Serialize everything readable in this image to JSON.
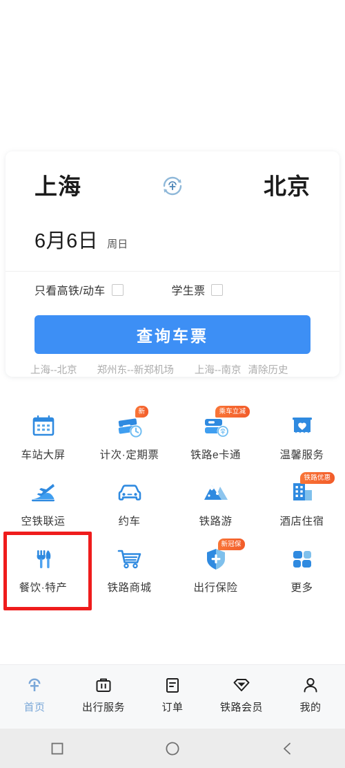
{
  "app": {
    "accent_blue": "#3d8ff5",
    "badge_orange": "#f4662e",
    "annotation_red": "#ef1c1c",
    "active_tab_color": "#7aa7d8"
  },
  "search_card": {
    "from_city": "上海",
    "to_city": "北京",
    "swap_icon": "swap-station-icon",
    "date": "6月6日",
    "weekday": "周日",
    "options": [
      {
        "label": "只看高铁/动车",
        "checked": false
      },
      {
        "label": "学生票",
        "checked": false
      }
    ],
    "query_button": "查询车票",
    "history": [
      "上海--北京",
      "郑州东--新郑机场",
      "上海--南京"
    ],
    "clear_history": "清除历史"
  },
  "services": [
    {
      "label": "车站大屏",
      "icon": "station-screen-icon",
      "badge": null
    },
    {
      "label": "计次·定期票",
      "icon": "multi-ride-ticket-icon",
      "badge": "新"
    },
    {
      "label": "铁路e卡通",
      "icon": "railway-ecard-icon",
      "badge": "乘车立减"
    },
    {
      "label": "温馨服务",
      "icon": "caring-service-icon",
      "badge": null
    },
    {
      "label": "空铁联运",
      "icon": "air-rail-transfer-icon",
      "badge": null
    },
    {
      "label": "约车",
      "icon": "hail-car-icon",
      "badge": null
    },
    {
      "label": "铁路游",
      "icon": "railway-tour-icon",
      "badge": null
    },
    {
      "label": "酒店住宿",
      "icon": "hotel-icon",
      "badge": "铁路优惠"
    },
    {
      "label": "餐饮·特产",
      "icon": "dining-specialty-icon",
      "badge": null
    },
    {
      "label": "铁路商城",
      "icon": "railway-mall-icon",
      "badge": null
    },
    {
      "label": "出行保险",
      "icon": "travel-insurance-icon",
      "badge": "新冠保"
    },
    {
      "label": "更多",
      "icon": "more-grid-icon",
      "badge": null
    }
  ],
  "tabbar": [
    {
      "label": "首页",
      "icon": "home-railway-icon",
      "active": true
    },
    {
      "label": "出行服务",
      "icon": "suitcase-icon",
      "active": false
    },
    {
      "label": "订单",
      "icon": "order-list-icon",
      "active": false
    },
    {
      "label": "铁路会员",
      "icon": "diamond-member-icon",
      "active": false
    },
    {
      "label": "我的",
      "icon": "person-icon",
      "active": false
    }
  ],
  "system_nav": [
    {
      "name": "recents-square-icon"
    },
    {
      "name": "home-circle-icon"
    },
    {
      "name": "back-chevron-icon"
    }
  ]
}
